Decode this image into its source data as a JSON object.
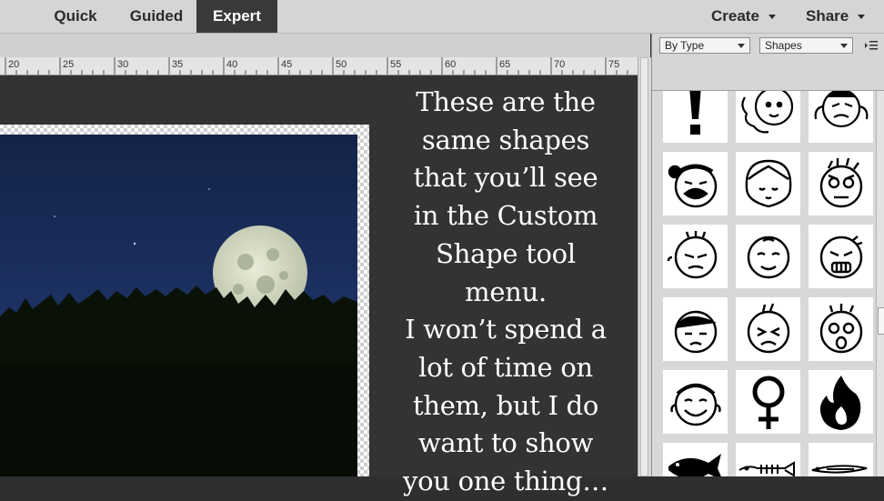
{
  "mode_bar": {
    "tabs": [
      {
        "label": "Quick"
      },
      {
        "label": "Guided"
      },
      {
        "label": "Expert",
        "active": true
      }
    ],
    "create_label": "Create",
    "share_label": "Share"
  },
  "ruler": {
    "labels": [
      "20",
      "25",
      "30",
      "35",
      "40",
      "45",
      "50",
      "55",
      "60",
      "65",
      "70",
      "75"
    ]
  },
  "callout": {
    "lines": [
      "These are the",
      "same shapes",
      "that you’ll see",
      "in the Custom",
      "Shape tool menu.",
      "I won’t spend a",
      "lot of time on",
      "them, but I do",
      "want to show",
      "you one thing…"
    ]
  },
  "panel": {
    "filter_dropdown": "By Type",
    "category_dropdown": "Shapes",
    "shapes": [
      "exclamation-shape",
      "curly-girl-face-shape",
      "pigtail-girl-face-shape",
      "crying-bun-face-shape",
      "bob-hair-face-shape",
      "angry-spiky-face-shape",
      "annoyed-face-shape",
      "smiling-bald-face-shape",
      "furious-face-shape",
      "sad-girl-face-shape",
      "wincing-face-shape",
      "shocked-face-shape",
      "grinning-face-shape",
      "female-symbol-shape",
      "fire-shape",
      "fish-shape",
      "fish-skeleton-shape",
      "long-fish-shape"
    ]
  },
  "colors": {
    "active_tab": "#3a3a3a",
    "workspace": "#333333",
    "panel": "#d6d6d6",
    "callout_text": "#ffffff"
  }
}
